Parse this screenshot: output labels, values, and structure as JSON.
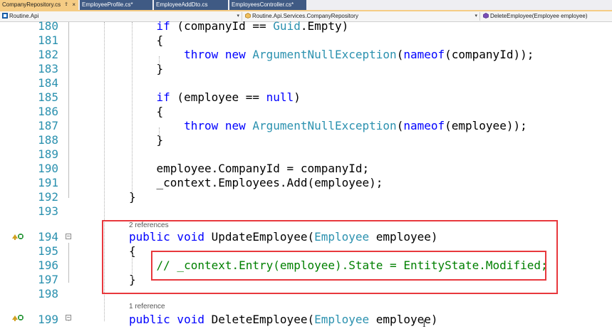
{
  "tabs": [
    {
      "label": "CompanyRepository.cs",
      "active": true,
      "pin": "⇪",
      "close": "×"
    },
    {
      "label": "EmployeeProfile.cs*",
      "active": false
    },
    {
      "label": "EmployeeAddDto.cs",
      "active": false
    },
    {
      "label": "EmployeesController.cs*",
      "active": false
    }
  ],
  "nav": {
    "project": "Routine.Api",
    "class": "Routine.Api.Services.CompanyRepository",
    "member": "DeleteEmployee(Employee employee)"
  },
  "lines": [
    {
      "num": "180",
      "tokens": [
        [
          "",
          "    "
        ],
        [
          "kw",
          "if"
        ],
        [
          "",
          " (companyId == "
        ],
        [
          "ty",
          "Guid"
        ],
        [
          "",
          ".Empty)"
        ]
      ]
    },
    {
      "num": "181",
      "tokens": [
        [
          "",
          "    {"
        ]
      ]
    },
    {
      "num": "182",
      "tokens": [
        [
          "",
          "        "
        ],
        [
          "kw",
          "throw new "
        ],
        [
          "ty",
          "ArgumentNullException"
        ],
        [
          "",
          "("
        ],
        [
          "kw",
          "nameof"
        ],
        [
          "",
          "(companyId));"
        ]
      ]
    },
    {
      "num": "183",
      "tokens": [
        [
          "",
          "    }"
        ]
      ]
    },
    {
      "num": "184",
      "tokens": []
    },
    {
      "num": "185",
      "tokens": [
        [
          "",
          "    "
        ],
        [
          "kw",
          "if"
        ],
        [
          "",
          " (employee == "
        ],
        [
          "kw",
          "null"
        ],
        [
          "",
          ")"
        ]
      ]
    },
    {
      "num": "186",
      "tokens": [
        [
          "",
          "    {"
        ]
      ]
    },
    {
      "num": "187",
      "tokens": [
        [
          "",
          "        "
        ],
        [
          "kw",
          "throw new "
        ],
        [
          "ty",
          "ArgumentNullException"
        ],
        [
          "",
          "("
        ],
        [
          "kw",
          "nameof"
        ],
        [
          "",
          "(employee));"
        ]
      ]
    },
    {
      "num": "188",
      "tokens": [
        [
          "",
          "    }"
        ]
      ]
    },
    {
      "num": "189",
      "tokens": []
    },
    {
      "num": "190",
      "tokens": [
        [
          "",
          "    employee.CompanyId = companyId;"
        ]
      ]
    },
    {
      "num": "191",
      "tokens": [
        [
          "",
          "    _context.Employees.Add(employee);"
        ]
      ]
    },
    {
      "num": "192",
      "tokens": [
        [
          "",
          "}"
        ]
      ]
    },
    {
      "num": "193",
      "tokens": []
    },
    {
      "num": "194",
      "tokens": [
        [
          "kw",
          "public void "
        ],
        [
          "",
          "UpdateEmployee("
        ],
        [
          "ty",
          "Employee"
        ],
        [
          "",
          " employee)"
        ]
      ]
    },
    {
      "num": "195",
      "tokens": [
        [
          "",
          "{"
        ]
      ]
    },
    {
      "num": "196",
      "tokens": [
        [
          "",
          "    "
        ],
        [
          "cm",
          "// _context.Entry(employee).State = EntityState.Modified;"
        ]
      ]
    },
    {
      "num": "197",
      "tokens": [
        [
          "",
          "}"
        ]
      ]
    },
    {
      "num": "198",
      "tokens": []
    },
    {
      "num": "199",
      "tokens": [
        [
          "kw",
          "public void "
        ],
        [
          "",
          "DeleteEmployee("
        ],
        [
          "ty",
          "Employee"
        ],
        [
          "",
          " employee)"
        ]
      ]
    }
  ],
  "codelens": {
    "update": "2 references",
    "delete": "1 reference"
  },
  "colors": {
    "keyword": "#0000ff",
    "type": "#2b91af",
    "comment": "#008000",
    "line_number": "#2b91af",
    "highlight_box": "#e8383d",
    "active_tab": "#f5cc84",
    "inactive_tab": "#3f5a84"
  },
  "icons": {
    "override": "override-arrow-icon",
    "collapse": "collapse-minus-icon"
  }
}
